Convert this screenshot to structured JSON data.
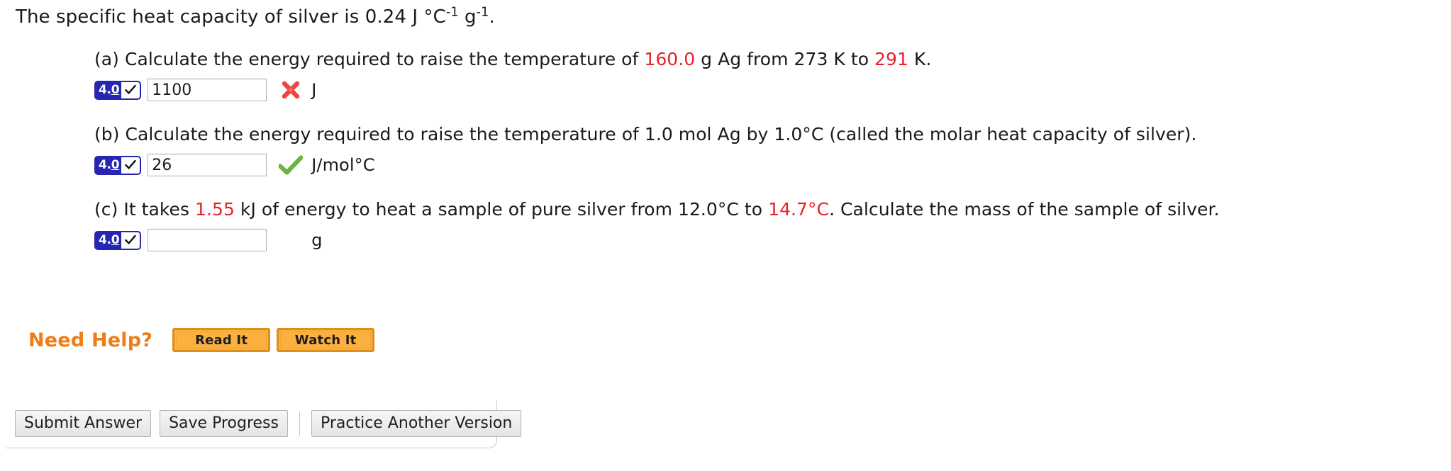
{
  "stem": {
    "text_before": "The specific heat capacity of silver is 0.24 J °C",
    "sup1": "-1",
    "text_mid": " g",
    "sup2": "-1",
    "text_after": "."
  },
  "parts": [
    {
      "label": "(a)",
      "segments": [
        {
          "text": "(a) Calculate the energy required to raise the temperature of ",
          "highlight": false
        },
        {
          "text": "160.0",
          "highlight": true
        },
        {
          "text": " g Ag from 273 K to ",
          "highlight": false
        },
        {
          "text": "291",
          "highlight": true
        },
        {
          "text": " K.",
          "highlight": false
        }
      ],
      "sigfig": "4.0",
      "input_value": "1100",
      "input_placeholder": "",
      "result": "incorrect",
      "unit": "J"
    },
    {
      "label": "(b)",
      "segments": [
        {
          "text": "(b) Calculate the energy required to raise the temperature of 1.0 mol Ag by 1.0°C (called the molar heat capacity of silver).",
          "highlight": false
        }
      ],
      "sigfig": "4.0",
      "input_value": "26",
      "input_placeholder": "",
      "result": "correct",
      "unit": "J/mol°C"
    },
    {
      "label": "(c)",
      "segments": [
        {
          "text": "(c) It takes ",
          "highlight": false
        },
        {
          "text": "1.55",
          "highlight": true
        },
        {
          "text": " kJ of energy to heat a sample of pure silver from 12.0°C to ",
          "highlight": false
        },
        {
          "text": "14.7°C",
          "highlight": true
        },
        {
          "text": ". Calculate the mass of the sample of silver.",
          "highlight": false
        }
      ],
      "sigfig": "4.0",
      "input_value": "",
      "input_placeholder": "",
      "result": "none",
      "unit": "g"
    }
  ],
  "need_help": {
    "label": "Need Help?",
    "read_button": "Read It",
    "watch_button": "Watch It"
  },
  "actions": {
    "submit": "Submit Answer",
    "save": "Save Progress",
    "practice": "Practice Another Version"
  },
  "colors": {
    "highlight": "#e8232a",
    "sigfig_badge": "#2626b0",
    "help_orange": "#ef7c14",
    "help_button_fill": "#fbb040",
    "correct_green": "#6cb33f",
    "incorrect_red": "#ee4444"
  }
}
